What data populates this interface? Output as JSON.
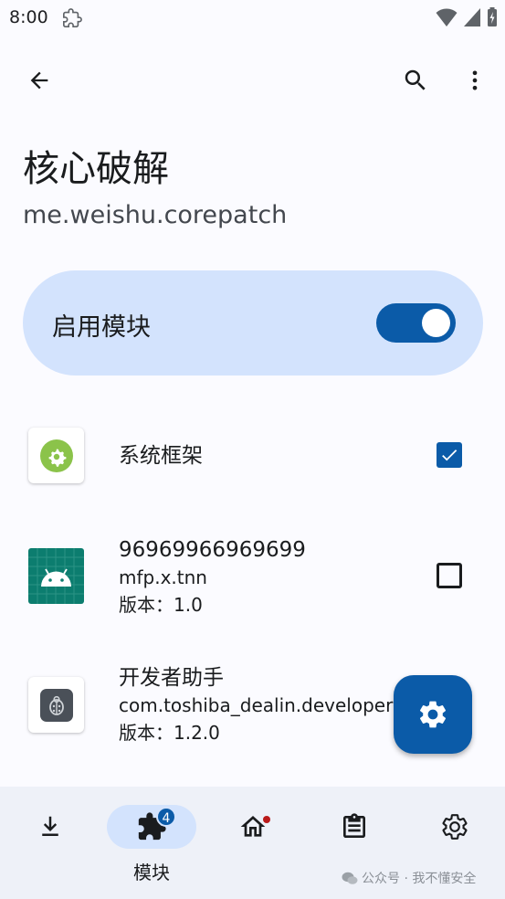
{
  "status_bar": {
    "time": "8:00"
  },
  "page": {
    "title": "核心破解",
    "package": "me.weishu.corepatch"
  },
  "enable_card": {
    "label": "启用模块",
    "enabled": true
  },
  "scope_list": [
    {
      "title": "系统框架",
      "lines": [],
      "checked": true,
      "icon": "android-system-gear-icon"
    },
    {
      "title": "96969966969699",
      "lines": [
        "mfp.x.tnn",
        "版本：1.0"
      ],
      "checked": false,
      "icon": "android-robot-icon"
    },
    {
      "title": "开发者助手",
      "lines": [
        "com.toshiba_dealin.developer",
        "版本：1.2.0"
      ],
      "checked": false,
      "icon": "ladybug-icon"
    }
  ],
  "bottom_nav": {
    "items": [
      {
        "label": "",
        "icon": "download-icon",
        "active": false
      },
      {
        "label": "模块",
        "icon": "puzzle-icon",
        "active": true,
        "badge": "4"
      },
      {
        "label": "",
        "icon": "home-icon",
        "active": false,
        "dot": true
      },
      {
        "label": "",
        "icon": "log-icon",
        "active": false
      },
      {
        "label": "",
        "icon": "settings-icon",
        "active": false
      }
    ]
  },
  "watermark": {
    "text": "公众号 · 我不懂安全"
  },
  "colors": {
    "accent": "#0b5ba8",
    "card": "#d3e3fd",
    "nav_bg": "#eef1f8"
  }
}
